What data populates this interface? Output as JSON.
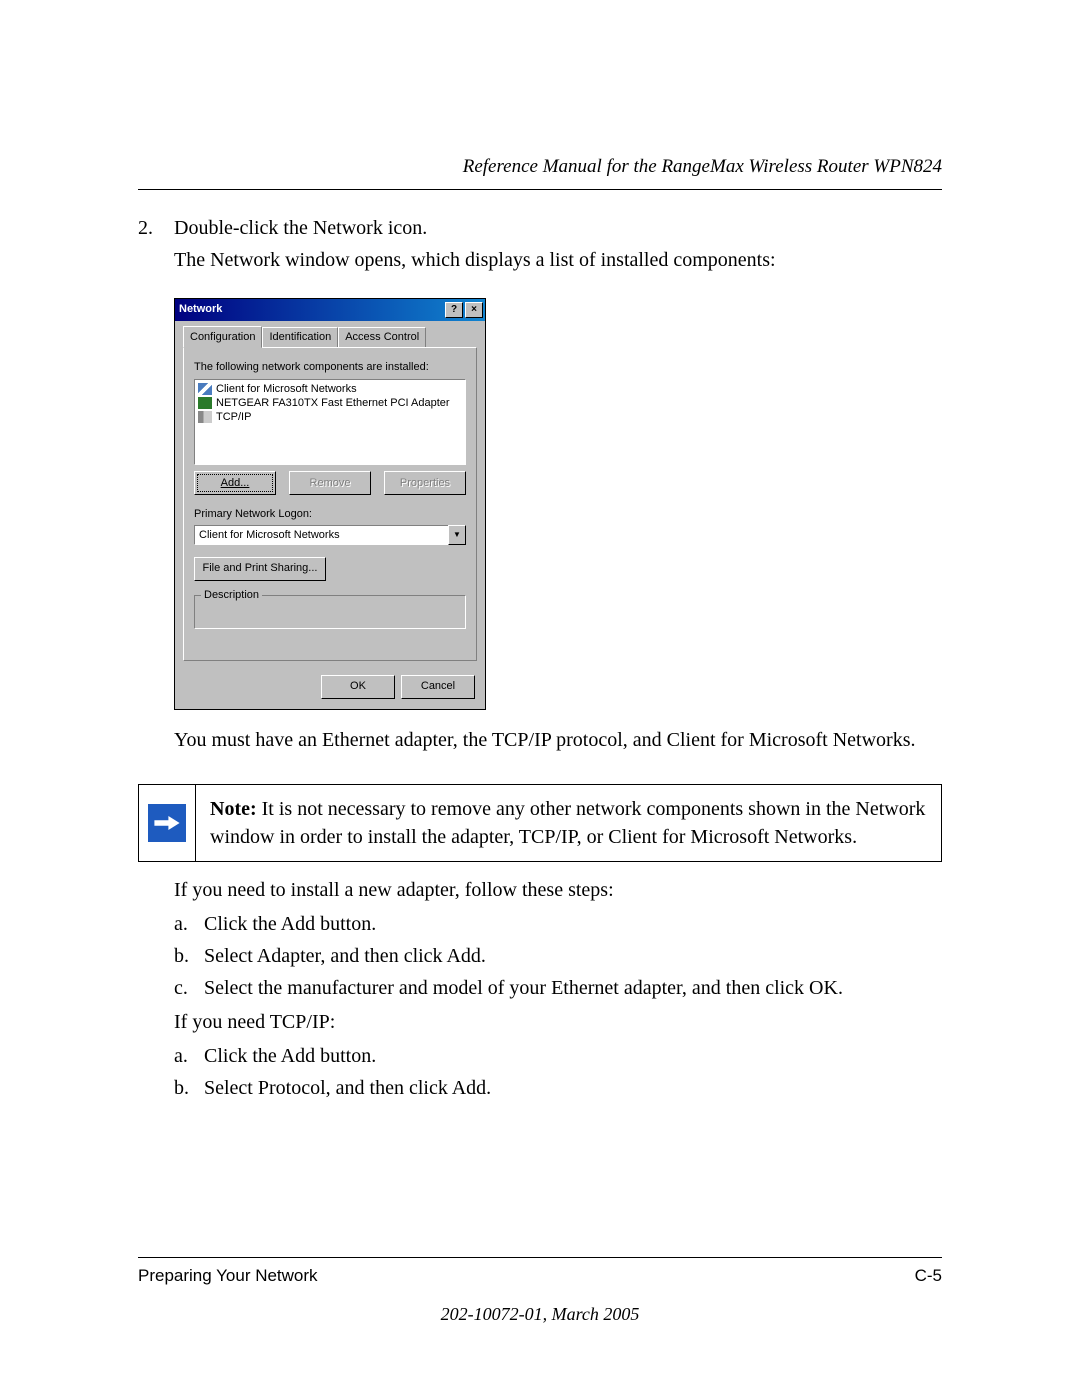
{
  "header": "Reference Manual for the RangeMax Wireless Router WPN824",
  "step_number": "2.",
  "step_line1": "Double-click the Network icon.",
  "step_line2": "The Network window opens, which displays a list of installed components:",
  "dialog": {
    "title": "Network",
    "help_btn": "?",
    "close_btn": "×",
    "tabs": {
      "t1": "Configuration",
      "t2": "Identification",
      "t3": "Access Control"
    },
    "list_label": "The following network components are installed:",
    "items": {
      "i1": "Client for Microsoft Networks",
      "i2": "NETGEAR FA310TX Fast Ethernet PCI Adapter",
      "i3": "TCP/IP"
    },
    "buttons": {
      "add": "Add...",
      "remove": "Remove",
      "props": "Properties"
    },
    "logon_label": "Primary Network Logon:",
    "logon_value": "Client for Microsoft Networks",
    "fps": "File and Print Sharing...",
    "desc_legend": "Description",
    "ok": "OK",
    "cancel": "Cancel"
  },
  "after_dialog": "You must have an Ethernet adapter, the TCP/IP protocol, and Client for Microsoft Networks.",
  "note": {
    "label": "Note:",
    "body": " It is not necessary to remove any other network components shown in the Network window in order to install the adapter, TCP/IP, or Client for Microsoft Networks."
  },
  "adapter_intro": "If you need to install a new adapter, follow these steps:",
  "adapter_steps": {
    "a": "Click the Add button.",
    "b": "Select Adapter, and then click Add.",
    "c": "Select the manufacturer and model of your Ethernet adapter, and then click OK."
  },
  "tcpip_intro": "If you need TCP/IP:",
  "tcpip_steps": {
    "a": "Click the Add button.",
    "b": "Select Protocol, and then click Add."
  },
  "footer": {
    "section": "Preparing Your Network",
    "page": "C-5",
    "docnum": "202-10072-01, March 2005"
  },
  "labels": {
    "a": "a.",
    "b": "b.",
    "c": "c."
  }
}
